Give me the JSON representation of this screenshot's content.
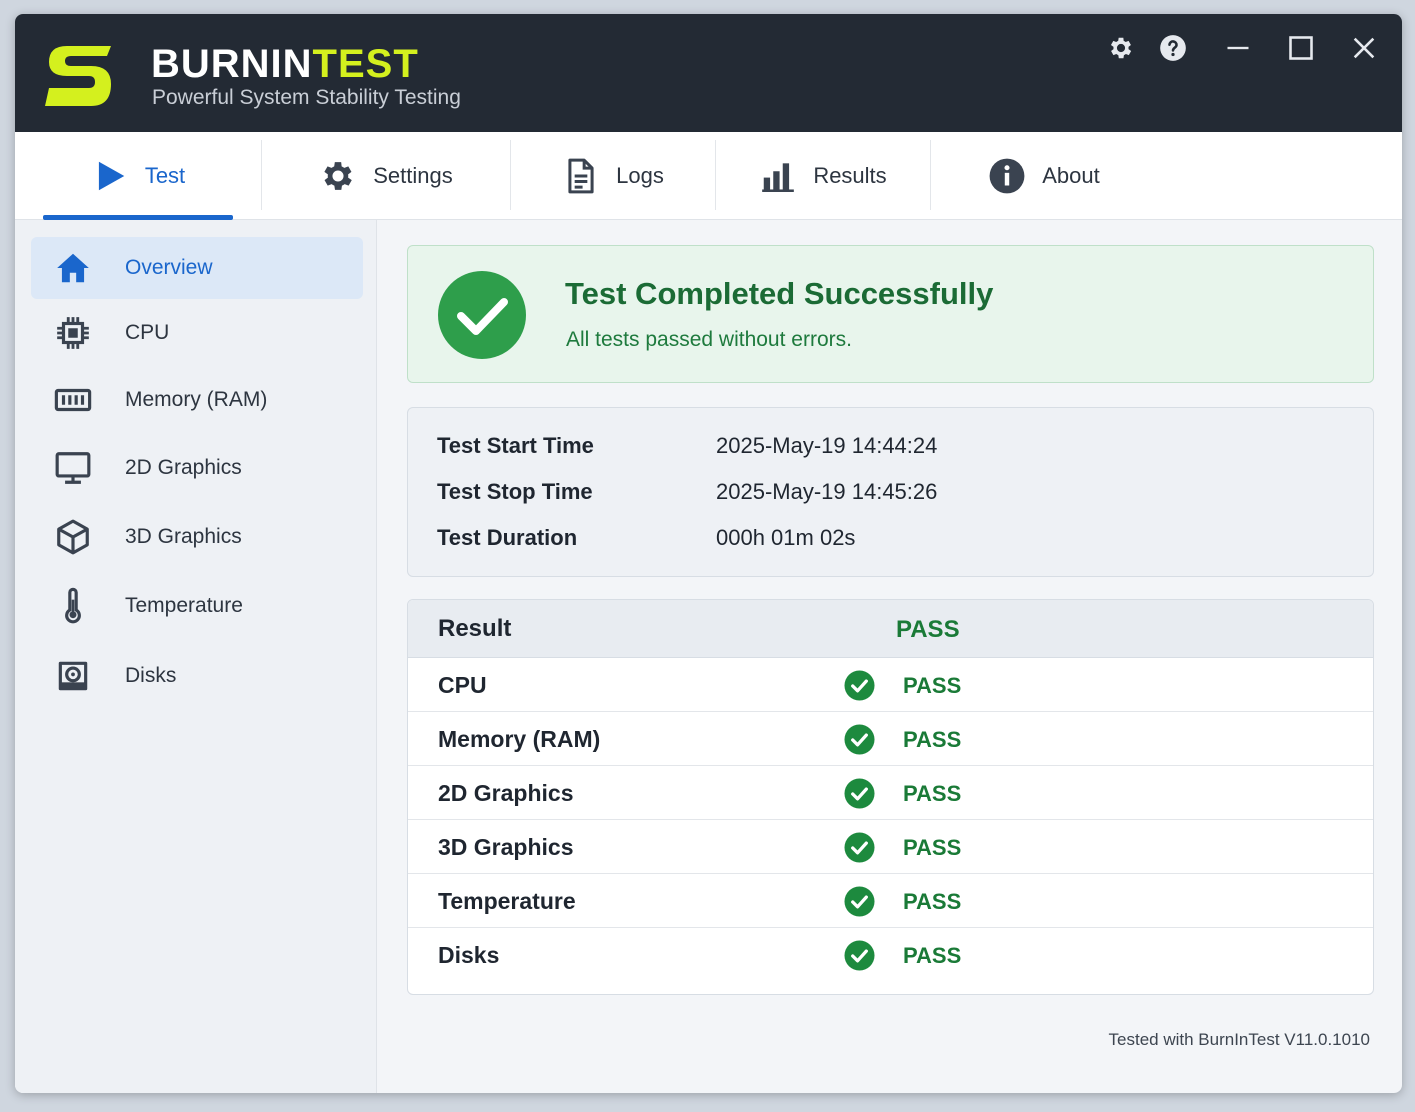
{
  "app": {
    "brand_part1": "BURNIN",
    "brand_part2": "TEST",
    "tagline": "Powerful System Stability Testing",
    "logo_letter": "S"
  },
  "window_controls": [
    "settings-icon",
    "help-icon",
    "minimize-icon",
    "maximize-icon",
    "close-icon"
  ],
  "tabs": [
    {
      "label": "Test",
      "icon": "play-icon",
      "active": true
    },
    {
      "label": "Settings",
      "icon": "gear-icon",
      "active": false
    },
    {
      "label": "Logs",
      "icon": "document-icon",
      "active": false
    },
    {
      "label": "Results",
      "icon": "bar-chart-icon",
      "active": false
    },
    {
      "label": "About",
      "icon": "info-icon",
      "active": false
    }
  ],
  "sidebar": {
    "items": [
      {
        "label": "Overview",
        "icon": "home-icon",
        "active": true
      },
      {
        "label": "CPU",
        "icon": "cpu-icon",
        "active": false
      },
      {
        "label": "Memory (RAM)",
        "icon": "memory-icon",
        "active": false
      },
      {
        "label": "2D Graphics",
        "icon": "monitor-icon",
        "active": false
      },
      {
        "label": "3D Graphics",
        "icon": "cube-icon",
        "active": false
      },
      {
        "label": "Temperature",
        "icon": "thermometer-icon",
        "active": false
      },
      {
        "label": "Disks",
        "icon": "disk-icon",
        "active": false
      }
    ]
  },
  "status": {
    "title": "Test Completed Successfully",
    "subtitle": "All tests passed without errors."
  },
  "times": [
    {
      "label": "Test Start Time",
      "value": "2025-May-19 14:44:24"
    },
    {
      "label": "Test Stop Time",
      "value": "2025-May-19 14:45:26"
    },
    {
      "label": "Test Duration",
      "value": "000h 01m 02s"
    }
  ],
  "results": {
    "header_label": "Result",
    "header_value": "PASS",
    "rows": [
      {
        "label": "CPU",
        "value": "PASS"
      },
      {
        "label": "Memory (RAM)",
        "value": "PASS"
      },
      {
        "label": "2D Graphics",
        "value": "PASS"
      },
      {
        "label": "3D Graphics",
        "value": "PASS"
      },
      {
        "label": "Temperature",
        "value": "PASS"
      },
      {
        "label": "Disks",
        "value": "PASS"
      }
    ]
  },
  "footer": "Tested with BurnInTest V11.0.1010",
  "colors": {
    "titlebar": "#232a34",
    "accent_blue": "#1a66cc",
    "brand_yellow": "#d4f01e",
    "pass_green": "#1a7a37",
    "success_bg": "#e8f5ec"
  }
}
